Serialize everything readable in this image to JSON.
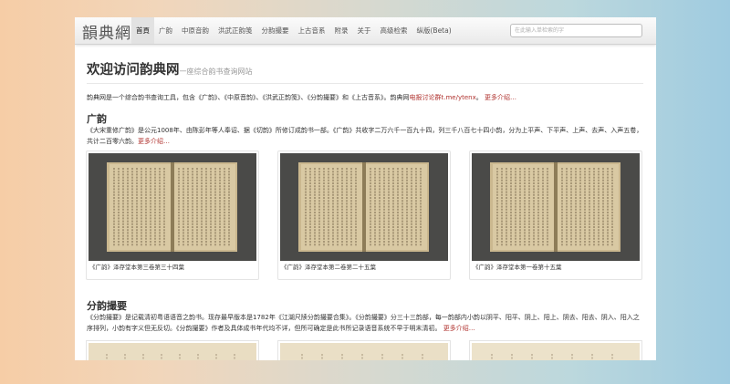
{
  "brand": "韻典網",
  "nav": {
    "items": [
      "首頁",
      "广韵",
      "中原音韵",
      "洪武正韵笺",
      "分韵撮要",
      "上古音系",
      "附录",
      "关于",
      "高级检索",
      "纵版(Beta)"
    ]
  },
  "search": {
    "placeholder": "在此输入单检索的字"
  },
  "hero": {
    "title": "欢迎访问韵典网",
    "subtitle": "一座综合韵书查询网站"
  },
  "intro": {
    "text": "韵典网是一个综合韵书查询工具，包含《广韵》、《中原音韵》、《洪武正韵笺》、《分韵撮要》和《上古音系》。韵典网",
    "link_text": "电报讨论群t.me/ytenx",
    "tail": "。",
    "more": "更多介绍…"
  },
  "guangyun": {
    "heading": "广韵",
    "desc": "《大宋重修广韵》是公元1008年、由陈彭年等人奉诏、据《切韵》所修订成韵书一部。《广韵》共收字二万六千一百九十四，列三千八百七十四小韵，分为上平声、下平声、上声、去声、入声五卷，共计二百零六韵。",
    "more": "更多介绍…",
    "images": [
      {
        "icon": "book-scan-image",
        "caption": "《广韵》泽存堂本第三卷第三十四葉"
      },
      {
        "icon": "book-scan-image",
        "caption": "《广韵》泽存堂本第二卷第二十五葉"
      },
      {
        "icon": "book-scan-image",
        "caption": "《广韵》泽存堂本第一卷第十五葉"
      }
    ]
  },
  "fenyun": {
    "heading": "分韵撮要",
    "desc": "《分韵撮要》是记载清初粤语语音之韵书。现存最早版本是1782年《江湖尺牍分韵撮要合集》。《分韵撮要》分三十三韵部，每一韵部内小韵以阴平、阳平、阴上、阳上、阴去、阳去、阴入、阳入之序排列，小韵有字义但无反切。《分韵撮要》作者及具体成书年代均不详，但所可确定是此书所记录语音系统不早于明末清初。",
    "more": "更多介绍…"
  },
  "colors": {
    "accent_link": "#b0332f",
    "scan_bg": "#4a4a48",
    "page_paper": "#d7c7a0"
  }
}
